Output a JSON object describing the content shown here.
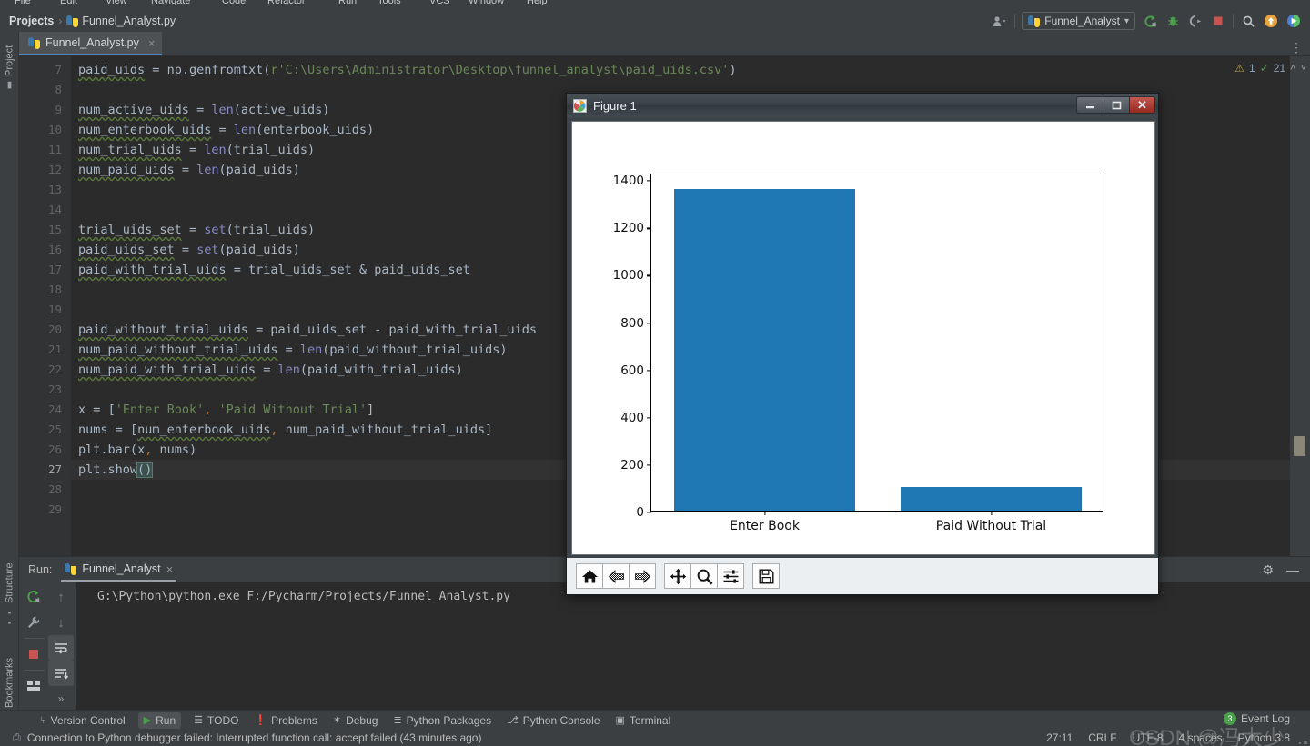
{
  "menubar": {
    "items": [
      "File",
      "Edit",
      "View",
      "Navigate",
      "Code",
      "Refactor",
      "Run",
      "Tools",
      "VCS",
      "Window",
      "Help"
    ]
  },
  "breadcrumb": {
    "project": "Projects",
    "separator": "›",
    "file": "Funnel_Analyst.py"
  },
  "toolbar": {
    "account_icon": "user-account-icon",
    "run_config": "Funnel_Analyst",
    "dropdown_caret": "▾",
    "run_icon": "run-icon",
    "debug_icon": "debug-icon",
    "coverage_icon": "run-with-coverage-icon",
    "stop_icon": "stop-icon",
    "search_icon": "⌕",
    "updates_icon": "updates-icon",
    "ai_icon": "ai-assistant-icon"
  },
  "left_rail": {
    "top": "Project",
    "items": [
      "Structure",
      "Bookmarks"
    ]
  },
  "editor_tab": {
    "label": "Funnel_Analyst.py",
    "close": "×"
  },
  "inspections": {
    "warning_count": "1",
    "ok_count": "21",
    "chevron_up": "˄",
    "chevron_down": "˅"
  },
  "code": {
    "first_line_number": 7,
    "caret_line": 27,
    "lines": [
      {
        "n": 7,
        "html": "paid_uids = np.genfromtxt(r'C:\\Users\\Administrator\\Desktop\\funnel_analyst\\paid_uids.csv')"
      },
      {
        "n": 8,
        "html": ""
      },
      {
        "n": 9,
        "html": "num_active_uids = len(active_uids)"
      },
      {
        "n": 10,
        "html": "num_enterbook_uids = len(enterbook_uids)"
      },
      {
        "n": 11,
        "html": "num_trial_uids = len(trial_uids)"
      },
      {
        "n": 12,
        "html": "num_paid_uids = len(paid_uids)"
      },
      {
        "n": 13,
        "html": ""
      },
      {
        "n": 14,
        "html": ""
      },
      {
        "n": 15,
        "html": "trial_uids_set = set(trial_uids)"
      },
      {
        "n": 16,
        "html": "paid_uids_set = set(paid_uids)"
      },
      {
        "n": 17,
        "html": "paid_with_trial_uids = trial_uids_set & paid_uids_set"
      },
      {
        "n": 18,
        "html": ""
      },
      {
        "n": 19,
        "html": ""
      },
      {
        "n": 20,
        "html": "paid_without_trial_uids = paid_uids_set - paid_with_trial_uids"
      },
      {
        "n": 21,
        "html": "num_paid_without_trial_uids = len(paid_without_trial_uids)"
      },
      {
        "n": 22,
        "html": "num_paid_with_trial_uids = len(paid_with_trial_uids)"
      },
      {
        "n": 23,
        "html": ""
      },
      {
        "n": 24,
        "html": "x = ['Enter Book', 'Paid Without Trial']"
      },
      {
        "n": 25,
        "html": "nums = [num_enterbook_uids, num_paid_without_trial_uids]"
      },
      {
        "n": 26,
        "html": "plt.bar(x, nums)"
      },
      {
        "n": 27,
        "html": "plt.show()"
      },
      {
        "n": 28,
        "html": ""
      },
      {
        "n": 29,
        "html": ""
      }
    ]
  },
  "figure_window": {
    "title": "Figure 1",
    "icon": "matplotlib-icon",
    "minimize": "—",
    "maximize": "□",
    "close": "✕",
    "toolbar": [
      {
        "name": "home-icon",
        "tooltip": "Home"
      },
      {
        "name": "back-arrow-icon",
        "tooltip": "Back"
      },
      {
        "name": "forward-arrow-icon",
        "tooltip": "Forward"
      },
      {
        "name": "pan-move-icon",
        "tooltip": "Pan"
      },
      {
        "name": "zoom-magnifier-icon",
        "tooltip": "Zoom to rectangle"
      },
      {
        "name": "configure-subplots-icon",
        "tooltip": "Configure subplots"
      },
      {
        "name": "save-floppy-icon",
        "tooltip": "Save the figure"
      }
    ]
  },
  "chart_data": {
    "type": "bar",
    "title": "",
    "xlabel": "",
    "ylabel": "",
    "categories": [
      "Enter Book",
      "Paid Without Trial"
    ],
    "values": [
      1360,
      100
    ],
    "yticks": [
      0,
      200,
      400,
      600,
      800,
      1000,
      1200,
      1400
    ],
    "ytick_labels": [
      "0",
      "200",
      "400",
      "600",
      "800",
      "1000",
      "1200",
      "1400"
    ],
    "ylim": [
      0,
      1428
    ],
    "grid": false,
    "legend": false,
    "bar_color": "#1f77b4",
    "background": "#ffffff"
  },
  "run_panel": {
    "label": "Run:",
    "tab": "Funnel_Analyst",
    "tab_close": "×",
    "console_line": "G:\\Python\\python.exe F:/Pycharm/Projects/Funnel_Analyst.py",
    "tools": [
      "rerun-icon",
      "settings-wrench-icon",
      "stop-icon",
      "layout-icon",
      "expand-icon",
      "scroll-up-icon",
      "scroll-down-icon",
      "soft-wrap-icon",
      "scroll-to-end-icon",
      "expand-right-icon"
    ],
    "gear_icon": "gear-icon",
    "hide_icon": "hide-panel-icon"
  },
  "tool_window_bar": {
    "items": [
      {
        "label": "Version Control",
        "icon": "branch-icon",
        "active": false
      },
      {
        "label": "Run",
        "icon": "play-icon",
        "active": true
      },
      {
        "label": "TODO",
        "icon": "list-icon",
        "active": false
      },
      {
        "label": "Problems",
        "icon": "error-icon",
        "active": false
      },
      {
        "label": "Debug",
        "icon": "bug-icon",
        "active": false
      },
      {
        "label": "Python Packages",
        "icon": "packages-icon",
        "active": false
      },
      {
        "label": "Python Console",
        "icon": "python-icon",
        "active": false
      },
      {
        "label": "Terminal",
        "icon": "terminal-icon",
        "active": false
      }
    ],
    "event_log": {
      "label": "Event Log",
      "count": "3"
    }
  },
  "status_bar": {
    "message_icon": "notification-icon",
    "message": "Connection to Python debugger failed: Interrupted function call: accept failed (43 minutes ago)",
    "right": [
      "27:11",
      "CRLF",
      "UTF-8",
      "4 spaces",
      "Python 3.8"
    ]
  },
  "watermark": {
    "text": "CSDN @冯大少"
  },
  "colors": {
    "ide_chrome": "#3c3f41",
    "editor_bg": "#2b2b2b",
    "accent_blue": "#4a88c7",
    "bar_blue": "#1f77b4",
    "string_green": "#6a8759",
    "keyword_orange": "#cc7832",
    "close_red": "#96291f"
  }
}
